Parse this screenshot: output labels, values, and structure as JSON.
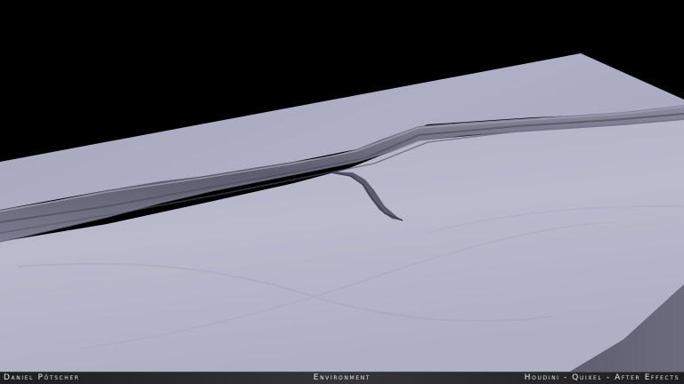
{
  "caption": {
    "left": "Daniel Pötscher",
    "center": "Environment",
    "right": "Houdini - Quixel - After Effects"
  },
  "colors": {
    "background": "#000000",
    "terrain": "#aaaac0",
    "cliff": "#6e6e80",
    "caption_text": "#e8e8ec"
  }
}
